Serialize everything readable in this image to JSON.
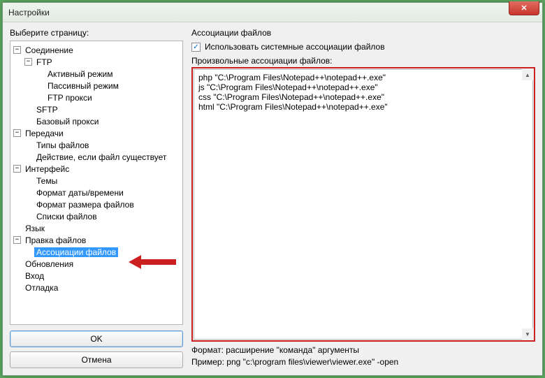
{
  "window": {
    "title": "Настройки",
    "close_label": "✕"
  },
  "left": {
    "select_page_label": "Выберите страницу:",
    "ok_label": "OK",
    "cancel_label": "Отмена"
  },
  "tree": {
    "connection": "Соединение",
    "ftp": "FTP",
    "active_mode": "Активный режим",
    "passive_mode": "Пассивный режим",
    "ftp_proxy": "FTP прокси",
    "sftp": "SFTP",
    "base_proxy": "Базовый прокси",
    "transfers": "Передачи",
    "file_types": "Типы файлов",
    "action_if_exists": "Действие, если файл существует",
    "interface": "Интерфейс",
    "themes": "Темы",
    "date_format": "Формат даты/времени",
    "size_format": "Формат размера файлов",
    "file_lists": "Списки файлов",
    "language": "Язык",
    "file_editing": "Правка файлов",
    "file_assoc": "Ассоциации файлов",
    "updates": "Обновления",
    "login": "Вход",
    "debug": "Отладка"
  },
  "right": {
    "section_title": "Ассоциации файлов",
    "use_system_label": "Использовать системные ассоциации файлов",
    "use_system_checked": true,
    "custom_label": "Произвольные ассоциации файлов:",
    "textarea_content": "php \"C:\\Program Files\\Notepad++\\notepad++.exe\"\njs \"C:\\Program Files\\Notepad++\\notepad++.exe\"\ncss \"C:\\Program Files\\Notepad++\\notepad++.exe\"\nhtml \"C:\\Program Files\\Notepad++\\notepad++.exe\"",
    "format_hint": "Формат: расширение \"команда\" аргументы",
    "example_hint": "Пример: png \"c:\\program files\\viewer\\viewer.exe\" -open"
  }
}
